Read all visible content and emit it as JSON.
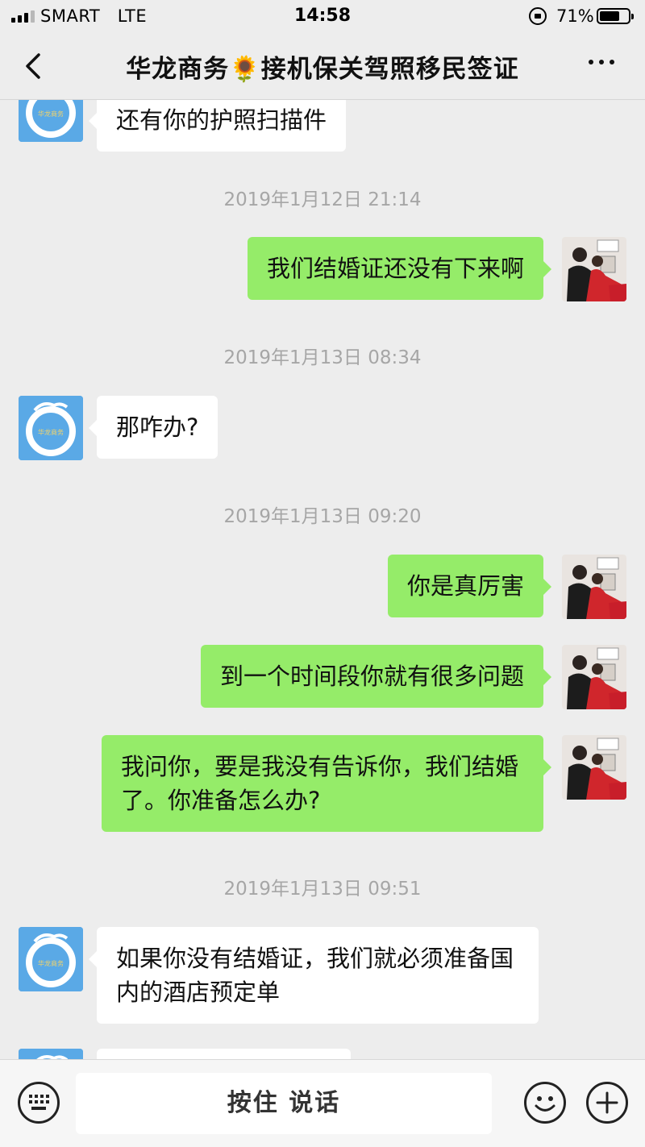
{
  "status_bar": {
    "carrier": "SMART",
    "network": "LTE",
    "time": "14:58",
    "battery_percent": "71%",
    "battery_level": 0.71
  },
  "nav": {
    "title": "华龙商务🌻接机保关驾照移民签证"
  },
  "messages": [
    {
      "type": "received",
      "text": "还有你的护照扫描件"
    },
    {
      "type": "timestamp",
      "text": "2019年1月12日 21:14"
    },
    {
      "type": "sent",
      "text": "我们结婚证还没有下来啊"
    },
    {
      "type": "timestamp",
      "text": "2019年1月13日 08:34"
    },
    {
      "type": "received",
      "text": "那咋办?"
    },
    {
      "type": "timestamp",
      "text": "2019年1月13日 09:20"
    },
    {
      "type": "sent",
      "text": "你是真厉害"
    },
    {
      "type": "sent",
      "text": "到一个时间段你就有很多问题"
    },
    {
      "type": "sent",
      "text": "我问你，要是我没有告诉你，我们结婚了。你准备怎么办?"
    },
    {
      "type": "timestamp",
      "text": "2019年1月13日 09:51"
    },
    {
      "type": "received",
      "text": "如果你没有结婚证，我们就必须准备国内的酒店预定单"
    }
  ],
  "input": {
    "voice_label": "按住 说话"
  },
  "colors": {
    "background": "#ededed",
    "sent_bubble": "#95ec69",
    "received_bubble": "#ffffff",
    "timestamp_text": "#a6a6a6",
    "avatar_blue": "#5aa9e6"
  },
  "icons": {
    "back": "chevron-left-icon",
    "more": "more-dots-icon",
    "keyboard": "keyboard-icon",
    "emoji": "emoji-icon",
    "plus": "plus-icon"
  }
}
